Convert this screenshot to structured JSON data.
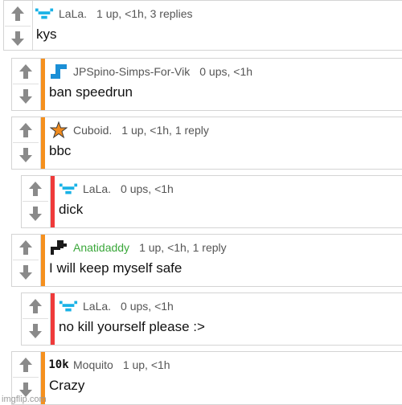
{
  "colors": {
    "orange_bar": "#f5901e",
    "red_bar": "#ef3a3a",
    "arrow_gray": "#8a8a8a",
    "lala_cyan": "#19b2e6",
    "green_user": "#3aa73a"
  },
  "comments": [
    {
      "username": "LaLa.",
      "stats": "1 up, <1h, 3 replies",
      "text": "kys",
      "avatar": "lala-logo-icon"
    },
    {
      "username": "JPSpino-Simps-For-Vik",
      "stats": "0 ups, <1h",
      "text": "ban speedrun",
      "avatar": "blue-tetromino-icon"
    },
    {
      "username": "Cuboid.",
      "stats": "1 up, <1h, 1 reply",
      "text": "bbc",
      "avatar": "orange-star-icon"
    },
    {
      "username": "LaLa.",
      "stats": "0 ups, <1h",
      "text": "dick",
      "avatar": "lala-logo-icon"
    },
    {
      "username": "Anatidaddy",
      "stats": "1 up, <1h, 1 reply",
      "text": "I will keep myself safe",
      "avatar": "black-duck-icon"
    },
    {
      "username": "LaLa.",
      "stats": "0 ups, <1h",
      "text": "no kill yourself please :>",
      "avatar": "lala-logo-icon"
    },
    {
      "username": "Moquito",
      "stats": "1 up, <1h",
      "text": "Crazy",
      "avatar": "10k-badge-icon",
      "avatar_text": "10k"
    }
  ],
  "watermark": "imgflip.com"
}
